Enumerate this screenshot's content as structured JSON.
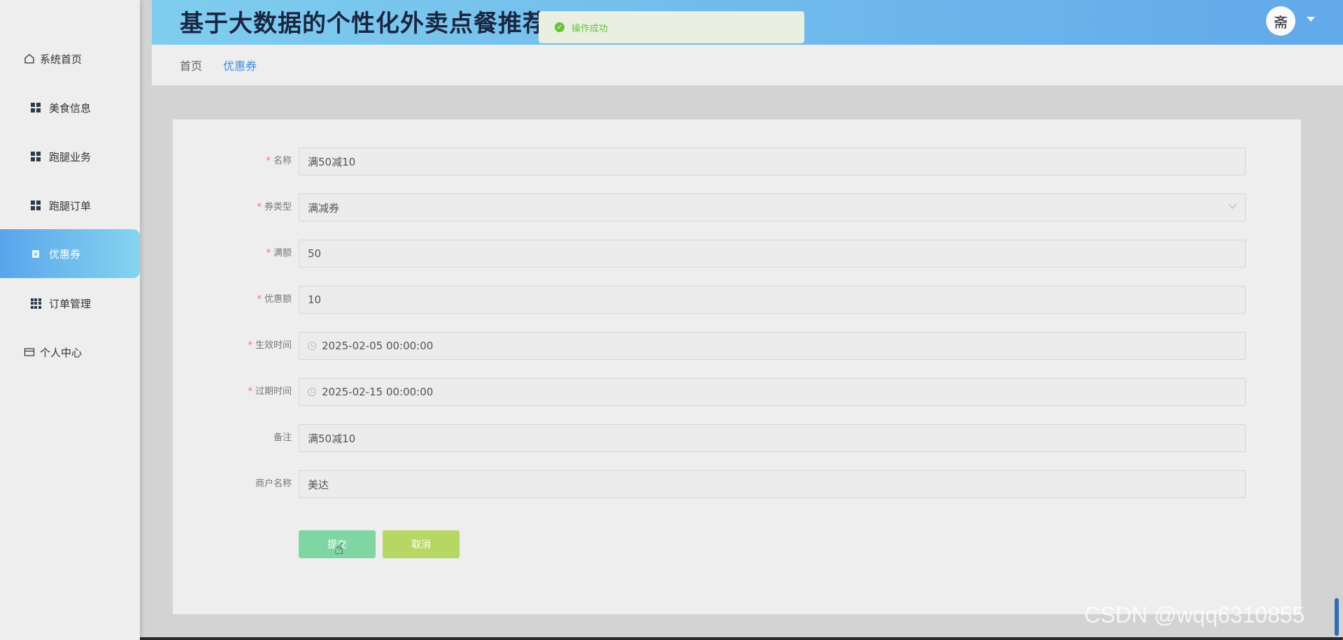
{
  "sidebar": {
    "items": [
      {
        "label": "系统首页",
        "icon": "home-icon"
      },
      {
        "label": "美食信息",
        "icon": "grid-icon"
      },
      {
        "label": "跑腿业务",
        "icon": "grid-icon"
      },
      {
        "label": "跑腿订单",
        "icon": "grid-icon"
      },
      {
        "label": "优惠券",
        "icon": "coupon-icon",
        "active": true
      },
      {
        "label": "订单管理",
        "icon": "grid9-icon"
      },
      {
        "label": "个人中心",
        "icon": "card-icon"
      }
    ]
  },
  "header": {
    "title": "基于大数据的个性化外卖点餐推荐",
    "avatar_glyph": "斋"
  },
  "toast": {
    "message": "操作成功",
    "icon": "success-check-icon",
    "color": "#67c23a"
  },
  "breadcrumb": {
    "home": "首页",
    "current": "优惠券"
  },
  "form": {
    "fields": [
      {
        "label": "名称",
        "required": true,
        "value": "满50减10"
      },
      {
        "label": "券类型",
        "required": true,
        "value": "满减券"
      },
      {
        "label": "满额",
        "required": true,
        "value": "50"
      },
      {
        "label": "优惠额",
        "required": true,
        "value": "10"
      },
      {
        "label": "生效时间",
        "required": true,
        "value": "2025-02-05 00:00:00"
      },
      {
        "label": "过期时间",
        "required": true,
        "value": "2025-02-15 00:00:00"
      },
      {
        "label": "备注",
        "required": false,
        "value": "满50减10"
      },
      {
        "label": "商户名称",
        "required": false,
        "value": "美达"
      }
    ],
    "submit_label": "提交",
    "cancel_label": "取消"
  },
  "watermark": "CSDN @wqq6310855",
  "colors": {
    "header_start": "#7fcdee",
    "header_end": "#62a9ea",
    "active_menu": "#5aa4ec",
    "submit": "#7fd6a2",
    "cancel": "#b7d764",
    "required": "#f56c6c"
  }
}
